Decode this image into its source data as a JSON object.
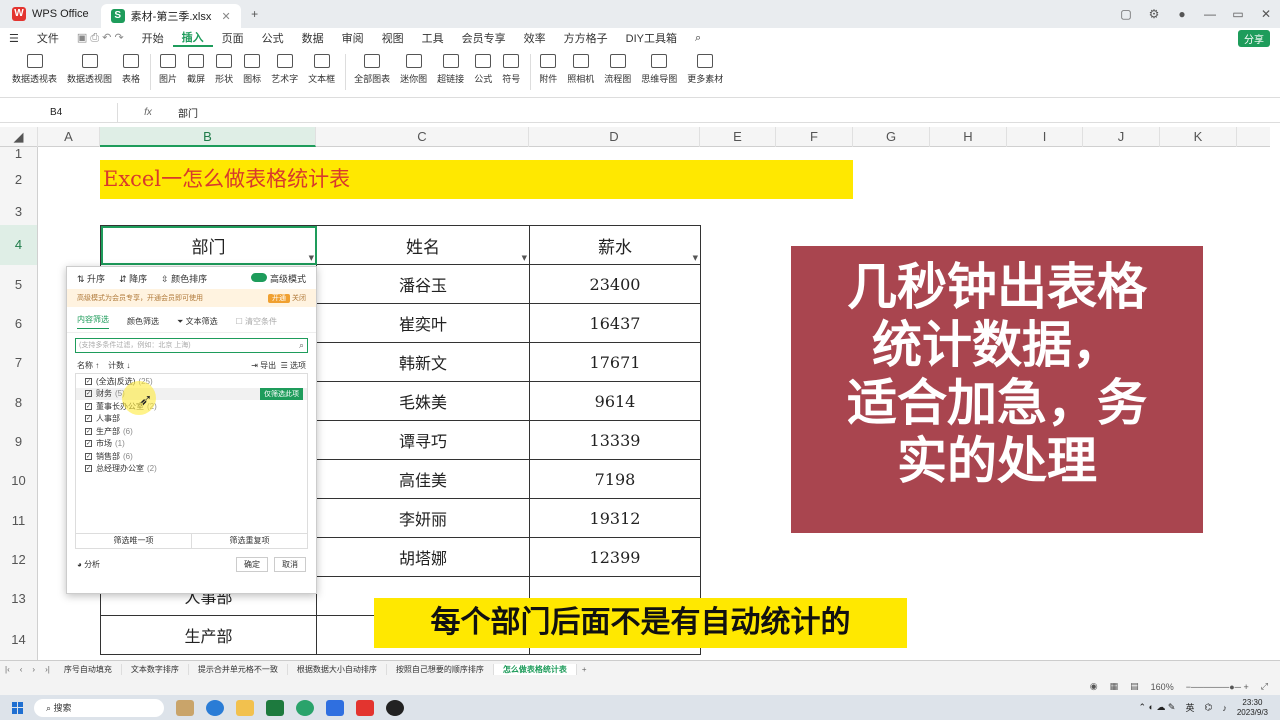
{
  "titlebar": {
    "app_name": "WPS Office",
    "file_tab": "素材-第三季.xlsx",
    "new_tab": "+"
  },
  "menu": {
    "file": "文件",
    "items": [
      "开始",
      "插入",
      "页面",
      "公式",
      "数据",
      "审阅",
      "视图",
      "工具",
      "会员专享",
      "效率",
      "方方格子",
      "DIY工具箱"
    ],
    "active": "插入",
    "share": "分享"
  },
  "ribbon": [
    "数据透视表",
    "数据透视图",
    "表格",
    "图片",
    "截屏",
    "形状",
    "图标",
    "艺术字",
    "文本框",
    "全部图表",
    "迷你图",
    "超链接",
    "公式",
    "符号",
    "附件",
    "照相机",
    "流程图",
    "思维导图",
    "更多素材"
  ],
  "formula": {
    "cell_ref": "B4",
    "fx": "fx",
    "content": "部门"
  },
  "columns": [
    "A",
    "B",
    "C",
    "D",
    "E",
    "F",
    "G",
    "H",
    "I",
    "J",
    "K"
  ],
  "rows": [
    "1",
    "2",
    "3",
    "4",
    "5",
    "6",
    "7",
    "8",
    "9",
    "10",
    "11",
    "12",
    "13",
    "14"
  ],
  "sheet_title": "Excel一怎么做表格统计表",
  "table": {
    "headers": [
      "部门",
      "姓名",
      "薪水"
    ],
    "rows": [
      {
        "name": "潘谷玉",
        "salary": "23400"
      },
      {
        "name": "崔奕叶",
        "salary": "16437"
      },
      {
        "name": "韩新文",
        "salary": "17671"
      },
      {
        "name": "毛姝美",
        "salary": "9614"
      },
      {
        "name": "谭寻巧",
        "salary": "13339"
      },
      {
        "name": "高佳美",
        "salary": "7198"
      },
      {
        "name": "李妍丽",
        "salary": "19312"
      },
      {
        "name": "胡塔娜",
        "salary": "12399"
      }
    ],
    "dept_rows": [
      "人事部",
      "生产部"
    ]
  },
  "promo": {
    "line1": "几秒钟出表格",
    "line2": "统计数据，",
    "line3": "适合加急，务",
    "line4": "实的处理"
  },
  "filter": {
    "sort_asc": "升序",
    "sort_desc": "降序",
    "color_sort": "颜色排序",
    "advanced": "高级模式",
    "notice": "高级模式为会员专享，开通会员即可使用",
    "open": "开通",
    "close": "关闭",
    "tab_content": "内容筛选",
    "tab_color": "颜色筛选",
    "text_filter": "文本筛选",
    "clear": "清空条件",
    "search_placeholder": "(支持多条件过滤，例如：北京 上海)",
    "col_name": "名称 ↑",
    "col_count": "计数 ↓",
    "export": "导出",
    "options": "选项",
    "items": [
      {
        "label": "(全选|反选)",
        "count": "(25)"
      },
      {
        "label": "财务",
        "count": "(5)"
      },
      {
        "label": "董事长办公室",
        "count": "(2)"
      },
      {
        "label": "人事部",
        "count": ""
      },
      {
        "label": "生产部",
        "count": "(6)"
      },
      {
        "label": "市场",
        "count": "(1)"
      },
      {
        "label": "销售部",
        "count": "(6)"
      },
      {
        "label": "总经理办公室",
        "count": "(2)"
      }
    ],
    "only_this": "仅筛选此项",
    "filter_only": "筛选唯一项",
    "filter_dup": "筛选重复项",
    "analysis": "分析",
    "ok": "确定",
    "cancel": "取消"
  },
  "subtitle": "每个部门后面不是有自动统计的",
  "sheet_tabs": [
    "序号自动填充",
    "文本数字排序",
    "提示合并单元格不一致",
    "根据数据大小自动排序",
    "按照自己想要的顺序排序",
    "怎么做表格统计表"
  ],
  "active_sheet": "怎么做表格统计表",
  "status": {
    "zoom": "160%"
  },
  "taskbar": {
    "search": "搜索",
    "ime": "英",
    "time": "23:30",
    "date": "2023/9/3"
  },
  "colors": {
    "accent": "#1e9c5b",
    "promo_bg": "#a9454f",
    "highlight": "#ffe800",
    "title_text": "#d83a2c"
  }
}
